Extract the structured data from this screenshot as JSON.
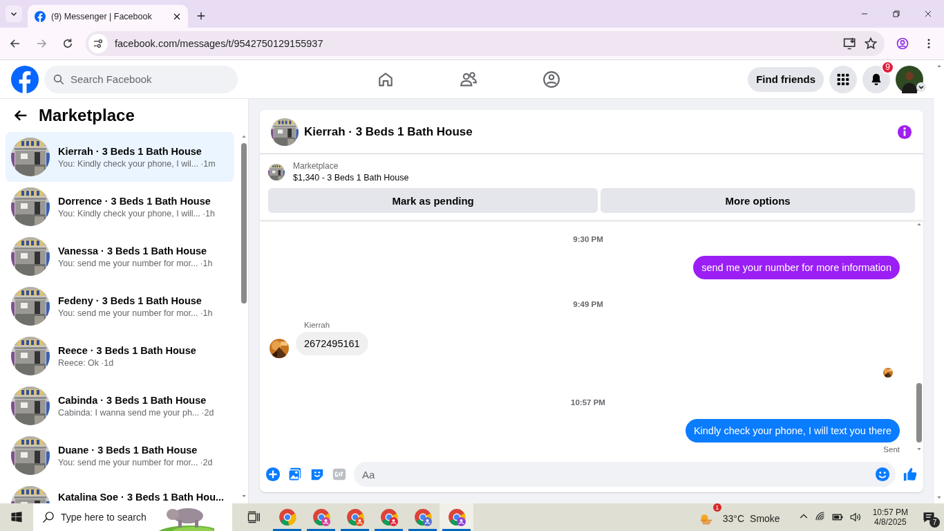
{
  "browser": {
    "tab": {
      "title": "(9) Messenger | Facebook",
      "selected": true
    },
    "url": "facebook.com/messages/t/9542750129155937"
  },
  "header": {
    "search_placeholder": "Search Facebook",
    "find_friends": "Find friends",
    "notification_count": "9"
  },
  "sidebar": {
    "title": "Marketplace",
    "conversations": [
      {
        "name": "Kierrah · 3 Beds 1 Bath House",
        "preview": "You: Kindly check your phone, I wil...",
        "time": "·1m",
        "selected": true
      },
      {
        "name": "Dorrence · 3 Beds 1 Bath House",
        "preview": "You: Kindly check your phone, I will...",
        "time": "·1h",
        "selected": false
      },
      {
        "name": "Vanessa · 3 Beds 1 Bath House",
        "preview": "You: send me your number for mor...",
        "time": "·1h",
        "selected": false
      },
      {
        "name": "Fedeny · 3 Beds 1 Bath House",
        "preview": "You: send me your number for mor...",
        "time": "·1h",
        "selected": false
      },
      {
        "name": "Reece · 3 Beds 1 Bath House",
        "preview": "Reece: Ok",
        "time": "·1d",
        "selected": false
      },
      {
        "name": "Cabinda · 3 Beds 1 Bath House",
        "preview": "Cabinda: I wanna send me your ph...",
        "time": "·2d",
        "selected": false
      },
      {
        "name": "Duane · 3 Beds 1 Bath House",
        "preview": "You: send me your number for mor...",
        "time": "·2d",
        "selected": false
      },
      {
        "name": "Katalina Soe · 3 Beds 1 Bath Hou...",
        "selected": false
      }
    ]
  },
  "chat": {
    "title": "Kierrah · 3 Beds 1 Bath House",
    "listing_label": "Marketplace",
    "listing_title": "$1,340 - 3 Beds 1 Bath House",
    "buttons": [
      "Mark as pending",
      "More options"
    ],
    "messages": [
      {
        "kind": "time",
        "text": "9:30 PM"
      },
      {
        "kind": "sent",
        "text": "send me your number for more information",
        "color": "#9b1ff4"
      },
      {
        "kind": "time",
        "text": "9:49 PM"
      },
      {
        "kind": "received",
        "sender": "Kierrah",
        "text": "2672495161"
      },
      {
        "kind": "seen"
      },
      {
        "kind": "time",
        "text": "10:57 PM"
      },
      {
        "kind": "sent",
        "text": "Kindly check your phone, I will text you there",
        "color": "#0a7cff",
        "status": "Sent"
      }
    ],
    "composer_placeholder": "Aa"
  },
  "taskbar": {
    "search_placeholder": "Type here to search",
    "apps": [
      {
        "kind": "taskview",
        "selected": false
      },
      {
        "kind": "chrome",
        "selected": false
      },
      {
        "kind": "chrome",
        "color": "#d6439b",
        "selected": false
      },
      {
        "kind": "chrome",
        "color": "#e4542b",
        "selected": false
      },
      {
        "kind": "chrome",
        "color": "#e0283c",
        "selected": false
      },
      {
        "kind": "chrome",
        "color": "#5a6fd6",
        "selected": false
      },
      {
        "kind": "chrome",
        "color": "#8e44d4",
        "selected": true
      }
    ],
    "weather_badge": "1",
    "temperature": "33°C",
    "weather": "Smoke",
    "time": "10:57 PM",
    "date": "4/8/2025",
    "notification_count": "7"
  }
}
